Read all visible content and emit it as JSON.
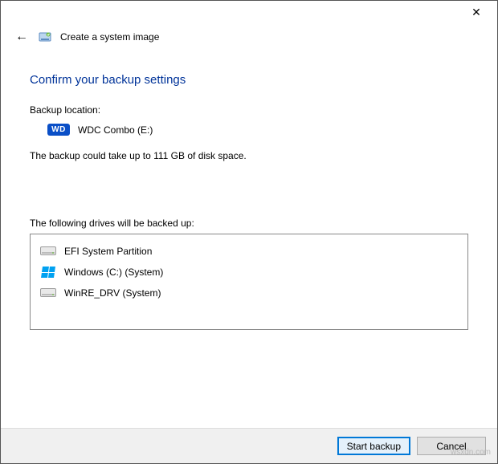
{
  "titlebar": {
    "close_glyph": "✕"
  },
  "header": {
    "back_glyph": "←",
    "title": "Create a system image"
  },
  "page": {
    "heading": "Confirm your backup settings",
    "backup_location_label": "Backup location:",
    "location": {
      "badge": "WD",
      "name": "WDC Combo (E:)"
    },
    "disk_note": "The backup could take up to 111 GB of disk space.",
    "drives_label": "The following drives will be backed up:",
    "drives": [
      {
        "icon": "hdd",
        "label": "EFI System Partition"
      },
      {
        "icon": "win",
        "label": "Windows (C:) (System)"
      },
      {
        "icon": "hdd",
        "label": "WinRE_DRV (System)"
      }
    ]
  },
  "footer": {
    "primary": "Start backup",
    "cancel": "Cancel"
  },
  "watermark": "wsxdn.com"
}
